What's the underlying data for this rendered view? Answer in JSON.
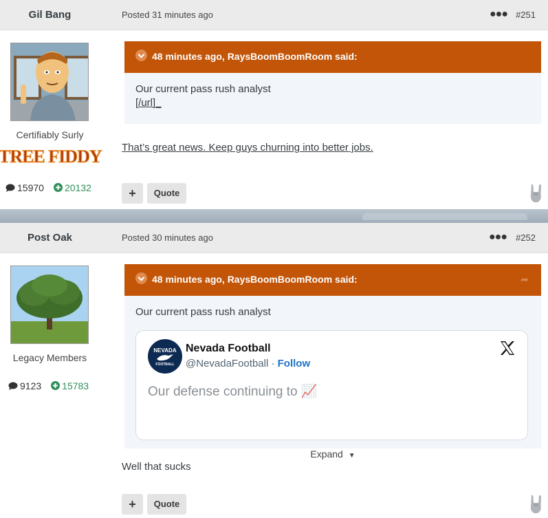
{
  "posts": [
    {
      "author": "Gil Bang",
      "posted": "Posted 31 minutes ago",
      "number": "#251",
      "member_title": "Certifiably Surly",
      "badge_text": "TREE FIDDY",
      "post_count": "15970",
      "reputation": "20132",
      "quote": {
        "header": "48 minutes ago, RaysBoomBoomRoom said:",
        "lines": [
          "Our current pass rush analyst",
          "[/url]_"
        ]
      },
      "text": "That’s great news. Keep guys churning into better jobs.",
      "plus_label": "+",
      "quote_label": "Quote"
    },
    {
      "author": "Post Oak",
      "posted": "Posted 30 minutes ago",
      "number": "#252",
      "member_title": "Legacy Members",
      "post_count": "9123",
      "reputation": "15783",
      "quote": {
        "header": "48 minutes ago, RaysBoomBoomRoom said:",
        "lines": [
          "Our current pass rush analyst"
        ],
        "embed": {
          "name": "Nevada Football",
          "handle": "@NevadaFootball",
          "separator": "·",
          "follow": "Follow",
          "logo_text": "NEVADA",
          "logo_sub": "FOOTBALL",
          "text": "Our defense continuing to 📈"
        },
        "expand": "Expand"
      },
      "text": "Well that sucks",
      "plus_label": "+",
      "quote_label": "Quote"
    }
  ],
  "icons": {
    "more": "more-options-icon",
    "comment": "comment-icon",
    "reputation": "plus-circle-icon",
    "reaction": "rock-hand-icon",
    "x_logo": "x-logo-icon",
    "chevron": "chevron-down-icon"
  },
  "colors": {
    "quote_header": "#c25508",
    "reputation": "#2f8f5b",
    "follow": "#1d72c6"
  }
}
